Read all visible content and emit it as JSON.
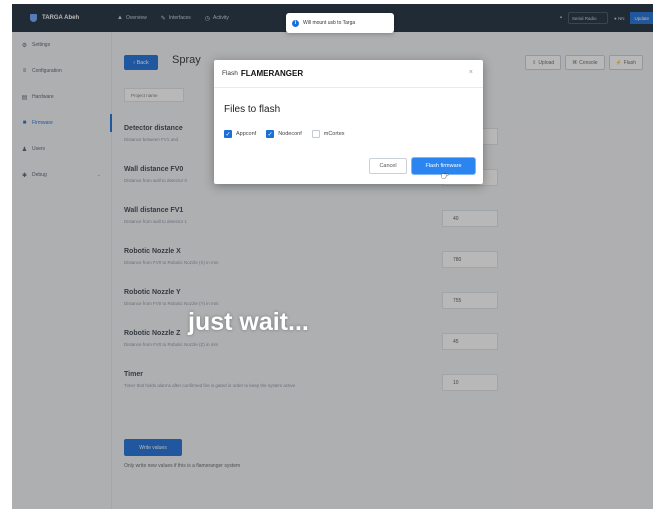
{
  "topbar": {
    "brand": "TARGA Abeh",
    "nav": [
      {
        "icon": "chart-icon",
        "glyph": "▲",
        "label": "Overview"
      },
      {
        "icon": "pencil-icon",
        "glyph": "✎",
        "label": "Interfaces"
      },
      {
        "icon": "clock-icon",
        "glyph": "◷",
        "label": "Activity"
      }
    ],
    "system_select": "Serial Radio",
    "tag": "● NN",
    "button": "Update"
  },
  "toast": {
    "icon": "i",
    "text": "Will mount usb to Targa"
  },
  "sidebar": {
    "items": [
      {
        "icon": "gear-icon",
        "glyph": "⚙",
        "label": "Settings"
      },
      {
        "icon": "sliders-icon",
        "glyph": "≡",
        "label": "Configuration"
      },
      {
        "icon": "hardware-icon",
        "glyph": "▤",
        "label": "Hardware"
      },
      {
        "icon": "firmware-icon",
        "glyph": "■",
        "label": "Firmware"
      },
      {
        "icon": "user-icon",
        "glyph": "♟",
        "label": "Users"
      },
      {
        "icon": "debug-icon",
        "glyph": "✱",
        "label": "Debug"
      }
    ]
  },
  "main": {
    "back_label": "‹ Back",
    "title": "Spray",
    "actions": [
      {
        "icon": "upload-icon",
        "glyph": "⇪",
        "label": "Upload"
      },
      {
        "icon": "console-icon",
        "glyph": "⌘",
        "label": "Console"
      },
      {
        "icon": "flash-icon",
        "glyph": "⚡",
        "label": "Flash"
      }
    ],
    "subtab": "Project name",
    "params": [
      {
        "title": "Detector distance",
        "desc": "Distance between FV1 and",
        "value": ""
      },
      {
        "title": "Wall distance FV0",
        "desc": "Distance from wall to detector 0",
        "value": "40"
      },
      {
        "title": "Wall distance FV1",
        "desc": "Distance from wall to detector 1",
        "value": "40"
      },
      {
        "title": "Robotic Nozzle X",
        "desc": "Distance from FV0 to Robotic Nozzle (X) in mm",
        "value": "780"
      },
      {
        "title": "Robotic Nozzle Y",
        "desc": "Distance from FV0 to Robotic Nozzle (Y) in mm",
        "value": "755"
      },
      {
        "title": "Robotic Nozzle Z",
        "desc": "Distance from FV0 to Robotic Nozzle (Z) in mm",
        "value": "45"
      },
      {
        "title": "Timer",
        "desc": "Timer that holds alarms after confirmed fire is gated in order to keep the system active",
        "value": "10"
      }
    ],
    "write_label": "Write values",
    "write_note": "Only write new values if this is a flameranger system"
  },
  "modal": {
    "label": "Flash",
    "device": "FLAMERANGER",
    "close": "×",
    "heading": "Files to flash",
    "files": [
      {
        "label": "Appconf",
        "checked": true
      },
      {
        "label": "Nodeconf",
        "checked": true
      },
      {
        "label": "mCortex",
        "checked": false
      }
    ],
    "cancel": "Cancel",
    "confirm": "Flash firmware"
  },
  "caption": "just wait..."
}
